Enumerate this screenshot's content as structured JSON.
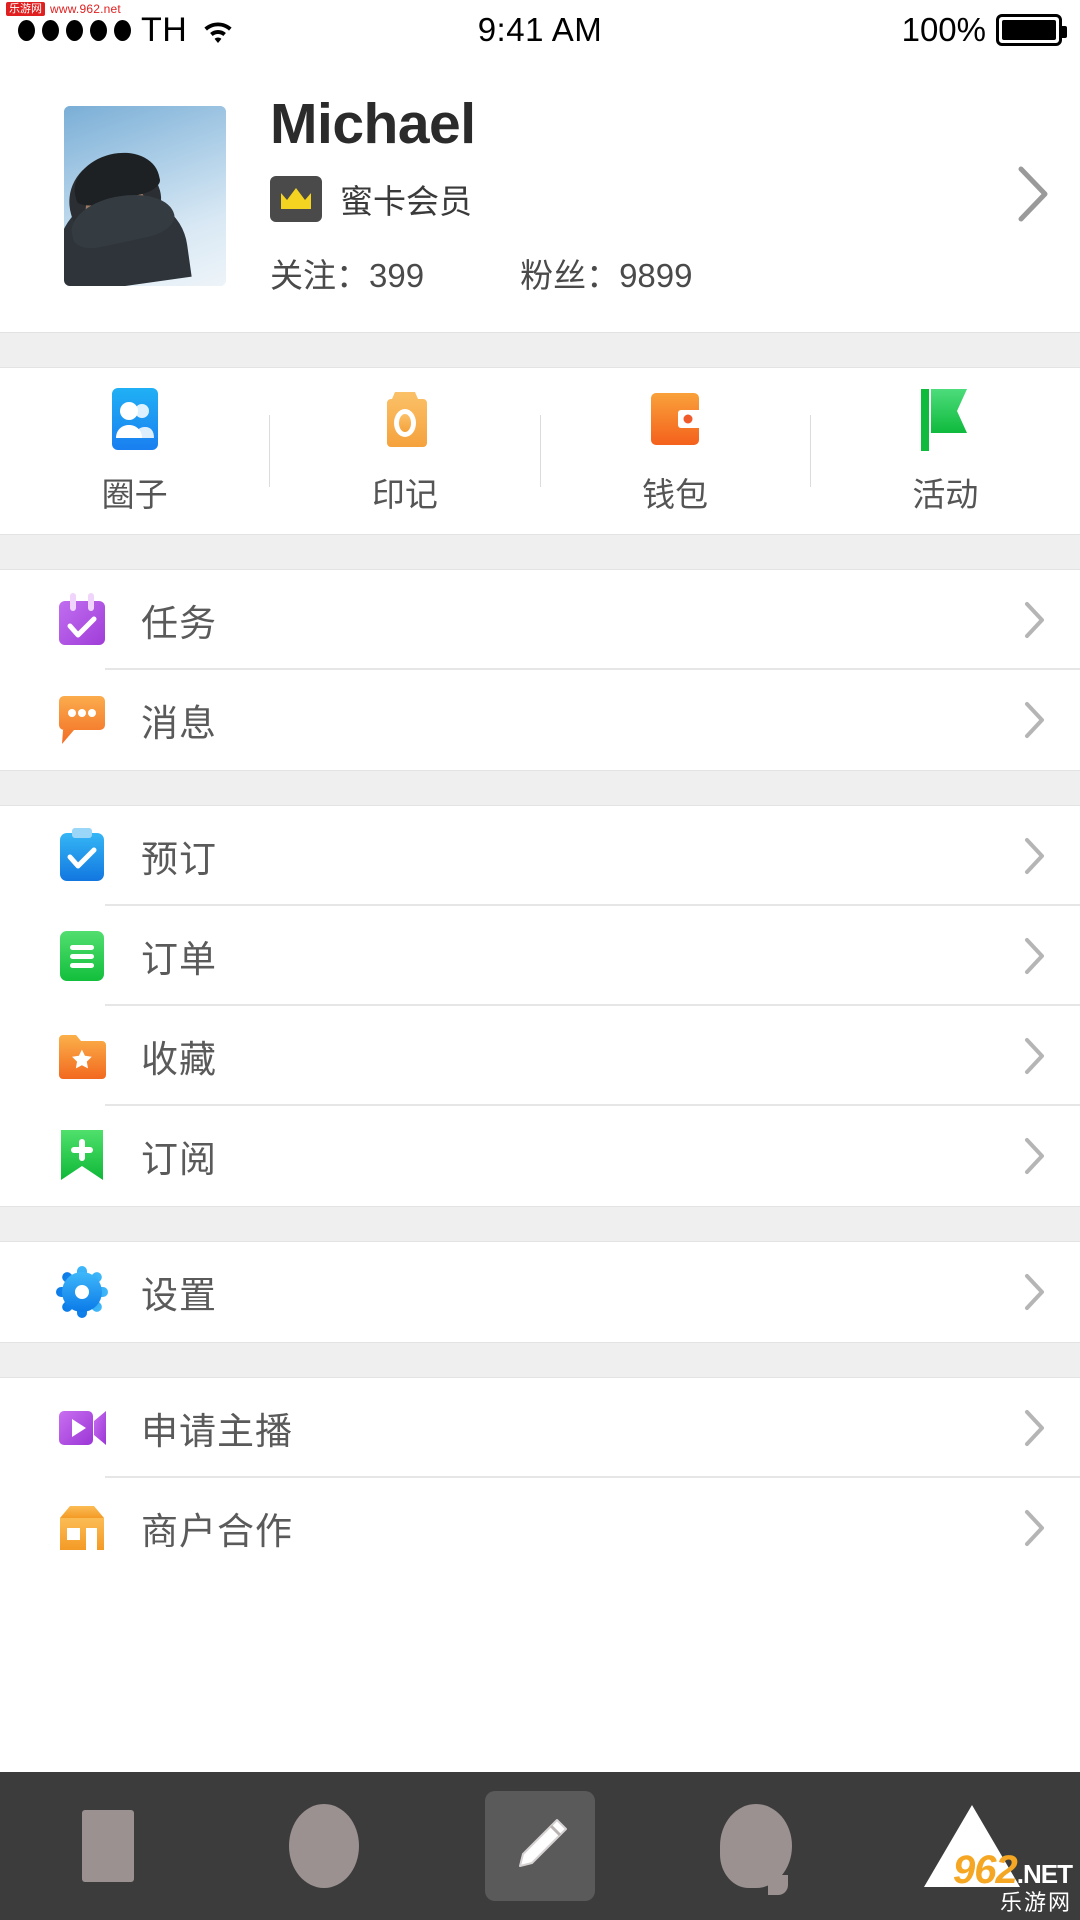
{
  "watermark": {
    "top_left_badge": "乐游网",
    "top_left_url": "www.962.net",
    "bottom_right_main": "962",
    "bottom_right_net": ".NET",
    "bottom_right_sub": "乐游网"
  },
  "status_bar": {
    "signal_icon": "signal-dots-icon",
    "carrier": "TH",
    "wifi_icon": "wifi-icon",
    "time": "9:41 AM",
    "battery_percent": "100%",
    "battery_icon": "battery-full-icon"
  },
  "profile": {
    "avatar_name": "avatar",
    "name": "Michael",
    "vip_icon": "crown-icon",
    "vip_label": "蜜卡会员",
    "following_label": "关注：",
    "following_count": "399",
    "followers_label": "粉丝：",
    "followers_count": "9899",
    "chevron_icon": "chevron-right-icon"
  },
  "quick_actions": [
    {
      "label": "圈子",
      "icon": "people-card-icon",
      "color": "#1a9ff0"
    },
    {
      "label": "印记",
      "icon": "camera-icon",
      "color": "#f7ad47"
    },
    {
      "label": "钱包",
      "icon": "wallet-icon",
      "color": "#f58020"
    },
    {
      "label": "活动",
      "icon": "flag-icon",
      "color": "#23c55e"
    }
  ],
  "groups": [
    {
      "group_name": "tasks-messages",
      "items": [
        {
          "label": "任务",
          "icon": "calendar-check-icon",
          "color": "#b35ae0"
        },
        {
          "label": "消息",
          "icon": "chat-bubble-icon",
          "color": "#f58a33"
        }
      ]
    },
    {
      "group_name": "orders",
      "items": [
        {
          "label": "预订",
          "icon": "clipboard-check-icon",
          "color": "#1a95ee"
        },
        {
          "label": "订单",
          "icon": "list-lines-icon",
          "color": "#2ecc56"
        },
        {
          "label": "收藏",
          "icon": "folder-star-icon",
          "color": "#f58a33"
        },
        {
          "label": "订阅",
          "icon": "bookmark-plus-icon",
          "color": "#25cc4e"
        }
      ]
    },
    {
      "group_name": "settings",
      "items": [
        {
          "label": "设置",
          "icon": "gear-icon",
          "color": "#2196f3"
        }
      ]
    },
    {
      "group_name": "partner",
      "items": [
        {
          "label": "申请主播",
          "icon": "video-play-icon",
          "color": "#b35ae0"
        },
        {
          "label": "商户合作",
          "icon": "shop-icon",
          "color": "#f5a033"
        }
      ]
    }
  ],
  "bottom_nav": [
    {
      "name": "recents-button",
      "icon": "rectangle-icon"
    },
    {
      "name": "home-button",
      "icon": "circle-icon"
    },
    {
      "name": "compose-button",
      "icon": "pencil-icon",
      "active": true
    },
    {
      "name": "chat-button",
      "icon": "speech-bubble-icon"
    },
    {
      "name": "back-button",
      "icon": "triangle-up-icon"
    }
  ]
}
